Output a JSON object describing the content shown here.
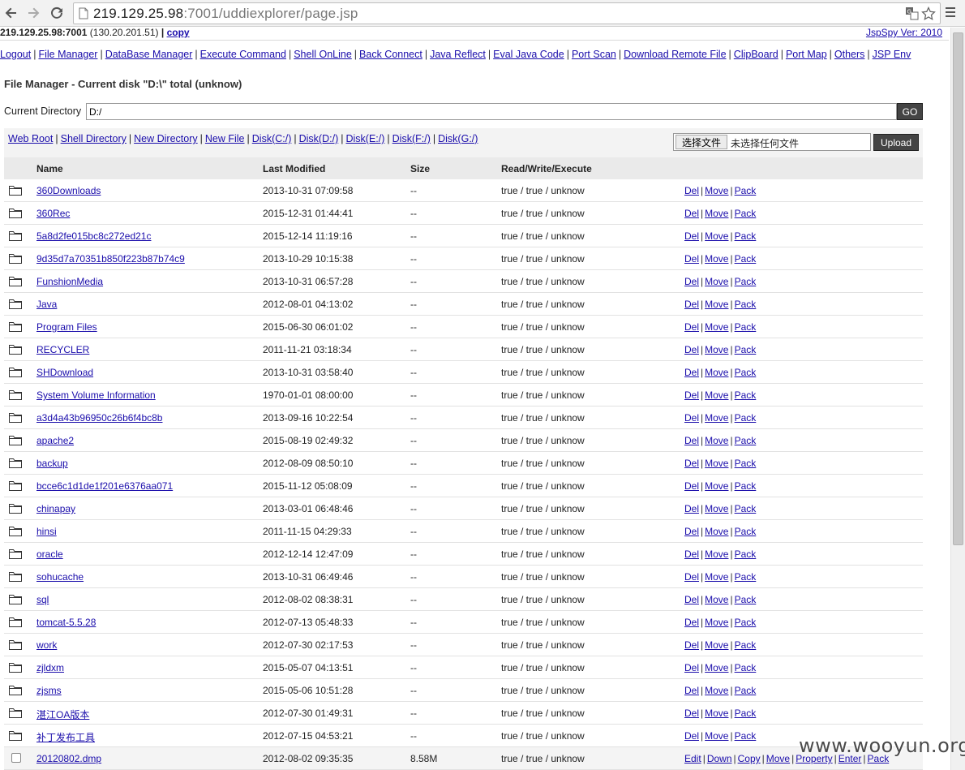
{
  "browser": {
    "url_host": "219.129.25.98",
    "url_path": ":7001/uddiexplorer/page.jsp"
  },
  "header": {
    "host": "219.129.25.98:7001",
    "client_ip": "(130.20.201.51)",
    "pipe": "|",
    "copy_label": "copy",
    "version": "JspSpy Ver: 2010"
  },
  "menu": [
    "Logout",
    "File Manager",
    "DataBase Manager",
    "Execute Command",
    "Shell OnLine",
    "Back Connect",
    "Java Reflect",
    "Eval Java Code",
    "Port Scan",
    "Download Remote File",
    "ClipBoard",
    "Port Map",
    "Others",
    "JSP Env"
  ],
  "file_manager": {
    "title": "File Manager - Current disk \"D:\\\" total (unknow)",
    "current_dir_label": "Current Directory",
    "current_dir_value": "D:/",
    "go_label": "GO",
    "toolbar_links": [
      "Web Root",
      "Shell Directory",
      "New Directory",
      "New File",
      "Disk(C:/)",
      "Disk(D:/)",
      "Disk(E:/)",
      "Disk(F:/)",
      "Disk(G:/)"
    ],
    "choose_file_label": "选择文件",
    "no_file_label": "未选择任何文件",
    "upload_label": "Upload",
    "columns": [
      "Name",
      "Last Modified",
      "Size",
      "Read/Write/Execute"
    ],
    "dir_actions": [
      "Del",
      "Move",
      "Pack"
    ],
    "file_actions": [
      "Edit",
      "Down",
      "Copy",
      "Move",
      "Property",
      "Enter",
      "Pack"
    ],
    "rows": [
      {
        "name": "360Downloads",
        "modified": "2013-10-31 07:09:58",
        "size": "--",
        "rwe": "true / true / unknow",
        "type": "dir"
      },
      {
        "name": "360Rec",
        "modified": "2015-12-31 01:44:41",
        "size": "--",
        "rwe": "true / true / unknow",
        "type": "dir"
      },
      {
        "name": "5a8d2fe015bc8c272ed21c",
        "modified": "2015-12-14 11:19:16",
        "size": "--",
        "rwe": "true / true / unknow",
        "type": "dir"
      },
      {
        "name": "9d35d7a70351b850f223b87b74c9",
        "modified": "2013-10-29 10:15:38",
        "size": "--",
        "rwe": "true / true / unknow",
        "type": "dir"
      },
      {
        "name": "FunshionMedia",
        "modified": "2013-10-31 06:57:28",
        "size": "--",
        "rwe": "true / true / unknow",
        "type": "dir"
      },
      {
        "name": "Java",
        "modified": "2012-08-01 04:13:02",
        "size": "--",
        "rwe": "true / true / unknow",
        "type": "dir"
      },
      {
        "name": "Program Files",
        "modified": "2015-06-30 06:01:02",
        "size": "--",
        "rwe": "true / true / unknow",
        "type": "dir"
      },
      {
        "name": "RECYCLER",
        "modified": "2011-11-21 03:18:34",
        "size": "--",
        "rwe": "true / true / unknow",
        "type": "dir"
      },
      {
        "name": "SHDownload",
        "modified": "2013-10-31 03:58:40",
        "size": "--",
        "rwe": "true / true / unknow",
        "type": "dir"
      },
      {
        "name": "System Volume Information",
        "modified": "1970-01-01 08:00:00",
        "size": "--",
        "rwe": "true / true / unknow",
        "type": "dir"
      },
      {
        "name": "a3d4a43b96950c26b6f4bc8b",
        "modified": "2013-09-16 10:22:54",
        "size": "--",
        "rwe": "true / true / unknow",
        "type": "dir"
      },
      {
        "name": "apache2",
        "modified": "2015-08-19 02:49:32",
        "size": "--",
        "rwe": "true / true / unknow",
        "type": "dir"
      },
      {
        "name": "backup",
        "modified": "2012-08-09 08:50:10",
        "size": "--",
        "rwe": "true / true / unknow",
        "type": "dir"
      },
      {
        "name": "bcce6c1d1de1f201e6376aa071",
        "modified": "2015-11-12 05:08:09",
        "size": "--",
        "rwe": "true / true / unknow",
        "type": "dir"
      },
      {
        "name": "chinapay",
        "modified": "2013-03-01 06:48:46",
        "size": "--",
        "rwe": "true / true / unknow",
        "type": "dir"
      },
      {
        "name": "hinsi",
        "modified": "2011-11-15 04:29:33",
        "size": "--",
        "rwe": "true / true / unknow",
        "type": "dir"
      },
      {
        "name": "oracle",
        "modified": "2012-12-14 12:47:09",
        "size": "--",
        "rwe": "true / true / unknow",
        "type": "dir"
      },
      {
        "name": "sohucache",
        "modified": "2013-10-31 06:49:46",
        "size": "--",
        "rwe": "true / true / unknow",
        "type": "dir"
      },
      {
        "name": "sql",
        "modified": "2012-08-02 08:38:31",
        "size": "--",
        "rwe": "true / true / unknow",
        "type": "dir"
      },
      {
        "name": "tomcat-5.5.28",
        "modified": "2012-07-13 05:48:33",
        "size": "--",
        "rwe": "true / true / unknow",
        "type": "dir"
      },
      {
        "name": "work",
        "modified": "2012-07-30 02:17:53",
        "size": "--",
        "rwe": "true / true / unknow",
        "type": "dir"
      },
      {
        "name": "zjldxm",
        "modified": "2015-05-07 04:13:51",
        "size": "--",
        "rwe": "true / true / unknow",
        "type": "dir"
      },
      {
        "name": "zjsms",
        "modified": "2015-05-06 10:51:28",
        "size": "--",
        "rwe": "true / true / unknow",
        "type": "dir"
      },
      {
        "name": "湛江OA版本",
        "modified": "2012-07-30 01:49:31",
        "size": "--",
        "rwe": "true / true / unknow",
        "type": "dir"
      },
      {
        "name": "补丁发布工具",
        "modified": "2012-07-15 04:53:21",
        "size": "--",
        "rwe": "true / true / unknow",
        "type": "dir"
      },
      {
        "name": "20120802.dmp",
        "modified": "2012-08-02 09:35:35",
        "size": "8.58M",
        "rwe": "true / true / unknow",
        "type": "file"
      }
    ]
  },
  "watermark": "www.wooyun.org"
}
